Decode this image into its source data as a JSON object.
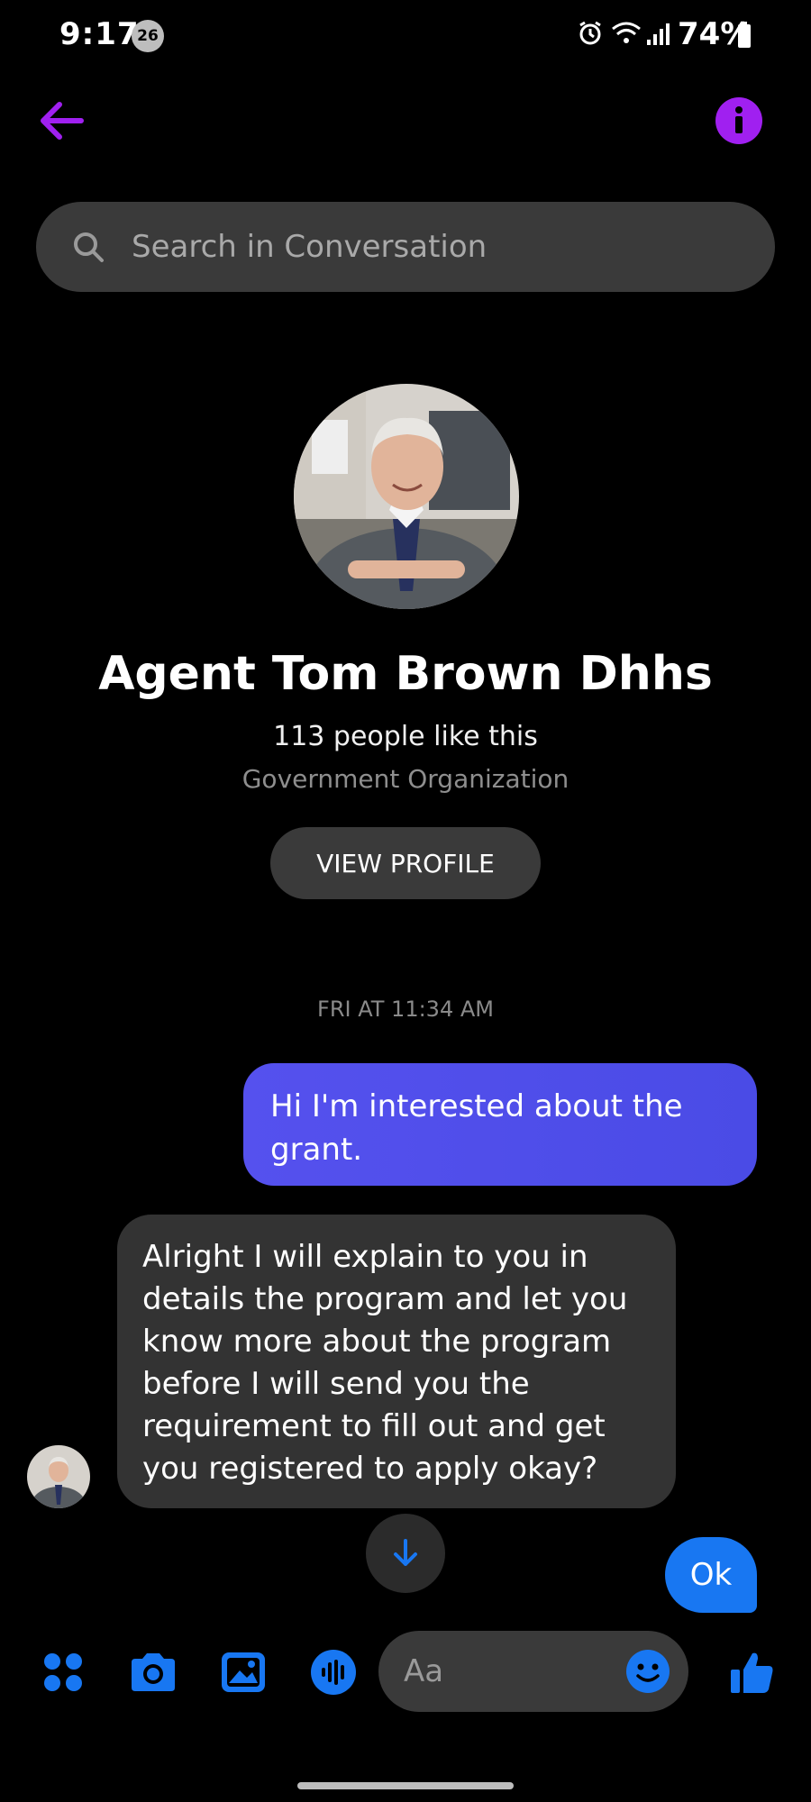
{
  "status_bar": {
    "time": "9:17",
    "notification_count": "26",
    "battery": "74%"
  },
  "header": {
    "back_icon": "arrow-left-icon",
    "info_icon": "info-icon",
    "accent_color": "#a020f0"
  },
  "search": {
    "placeholder": "Search in Conversation"
  },
  "profile": {
    "name": "Agent Tom Brown Dhhs",
    "likes": "113 people like this",
    "category": "Government Organization",
    "view_profile_label": "VIEW PROFILE"
  },
  "conversation": {
    "timestamp": "FRI AT 11:34 AM",
    "messages": [
      {
        "direction": "outgoing",
        "text": "Hi I'm interested about the grant."
      },
      {
        "direction": "incoming",
        "text": "Alright I will explain to you in details the program and let you know more about the program before I will send you the requirement to fill out and get you registered to apply okay?"
      }
    ],
    "quick_reply": "Ok"
  },
  "composer": {
    "placeholder": "Aa",
    "icons": [
      "apps-icon",
      "camera-icon",
      "gallery-icon",
      "voice-icon",
      "emoji-icon",
      "thumbs-up-icon"
    ],
    "icon_color": "#1877f2"
  }
}
